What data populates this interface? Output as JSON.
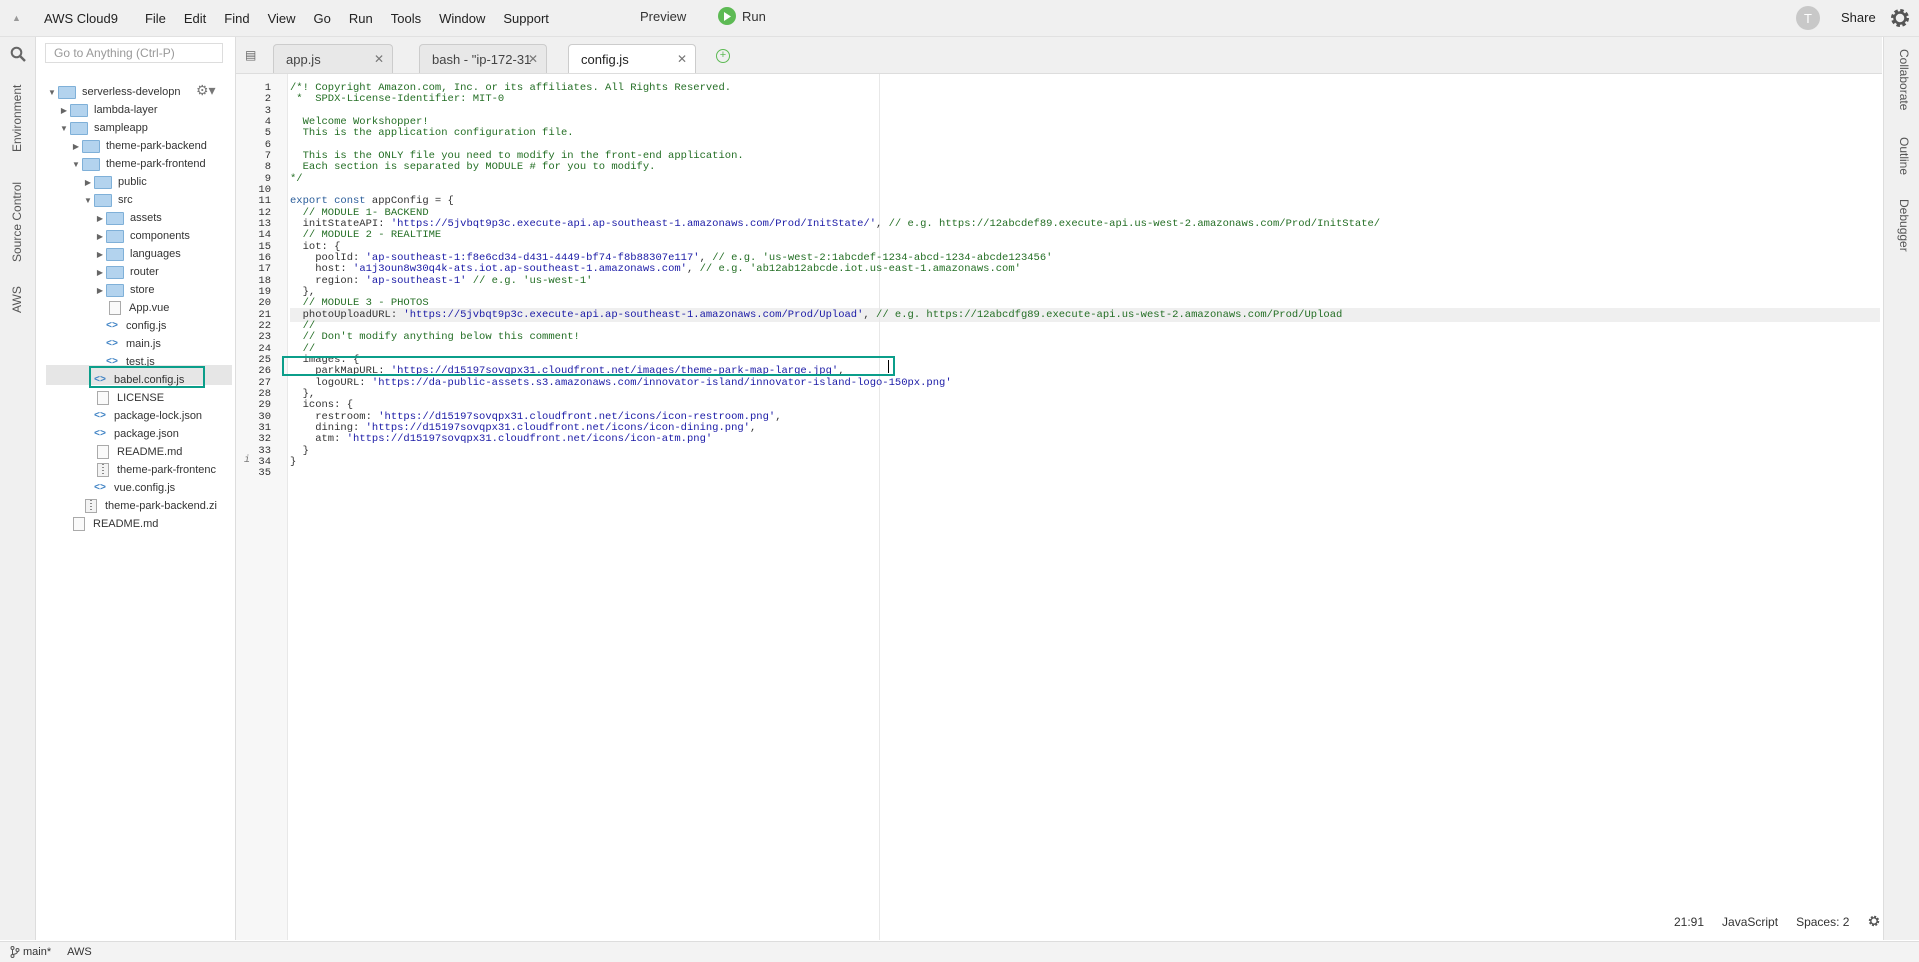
{
  "menubar": {
    "brand": "AWS Cloud9",
    "items": [
      "File",
      "Edit",
      "Find",
      "View",
      "Go",
      "Run",
      "Tools",
      "Window",
      "Support"
    ],
    "preview": "Preview",
    "run": "Run",
    "avatar_initial": "T",
    "share": "Share"
  },
  "left_tabs": [
    "Environment",
    "Source Control",
    "AWS"
  ],
  "right_tabs": [
    "Collaborate",
    "Outline",
    "Debugger"
  ],
  "goto": {
    "placeholder": "Go to Anything (Ctrl-P)"
  },
  "tree": [
    {
      "label": "serverless-developn",
      "kind": "folder",
      "expanded": true,
      "depth": 0
    },
    {
      "label": "lambda-layer",
      "kind": "folder",
      "expanded": false,
      "depth": 1
    },
    {
      "label": "sampleapp",
      "kind": "folder",
      "expanded": true,
      "depth": 1
    },
    {
      "label": "theme-park-backend",
      "kind": "folder",
      "expanded": false,
      "depth": 2
    },
    {
      "label": "theme-park-frontend",
      "kind": "folder",
      "expanded": true,
      "depth": 2
    },
    {
      "label": "public",
      "kind": "folder",
      "expanded": false,
      "depth": 3
    },
    {
      "label": "src",
      "kind": "folder",
      "expanded": true,
      "depth": 3
    },
    {
      "label": "assets",
      "kind": "folder",
      "expanded": false,
      "depth": 4
    },
    {
      "label": "components",
      "kind": "folder",
      "expanded": false,
      "depth": 4
    },
    {
      "label": "languages",
      "kind": "folder",
      "expanded": false,
      "depth": 4
    },
    {
      "label": "router",
      "kind": "folder",
      "expanded": false,
      "depth": 4
    },
    {
      "label": "store",
      "kind": "folder",
      "expanded": false,
      "depth": 4
    },
    {
      "label": "App.vue",
      "kind": "file",
      "depth": 4
    },
    {
      "label": "config.js",
      "kind": "code",
      "depth": 4,
      "selected": true
    },
    {
      "label": "main.js",
      "kind": "code",
      "depth": 4
    },
    {
      "label": "test.js",
      "kind": "code",
      "depth": 4
    },
    {
      "label": "babel.config.js",
      "kind": "code",
      "depth": 3
    },
    {
      "label": "LICENSE",
      "kind": "file",
      "depth": 3
    },
    {
      "label": "package-lock.json",
      "kind": "code",
      "depth": 3
    },
    {
      "label": "package.json",
      "kind": "code",
      "depth": 3
    },
    {
      "label": "README.md",
      "kind": "file",
      "depth": 3
    },
    {
      "label": "theme-park-frontenc",
      "kind": "zip",
      "depth": 3
    },
    {
      "label": "vue.config.js",
      "kind": "code",
      "depth": 3
    },
    {
      "label": "theme-park-backend.zi",
      "kind": "zip",
      "depth": 2
    },
    {
      "label": "README.md",
      "kind": "file",
      "depth": 1
    }
  ],
  "tabs": [
    {
      "label": "app.js",
      "active": false
    },
    {
      "label": "bash - \"ip-172-31",
      "active": false
    },
    {
      "label": "config.js",
      "active": true
    }
  ],
  "code_lines": [
    [
      {
        "t": "/*! Copyright Amazon.com, Inc. or its affiliates. All Rights Reserved.",
        "c": "comment"
      }
    ],
    [
      {
        "t": " *  SPDX-License-Identifier: MIT-0",
        "c": "comment"
      }
    ],
    [
      {
        "t": "",
        "c": ""
      }
    ],
    [
      {
        "t": "  Welcome Workshopper!",
        "c": "comment"
      }
    ],
    [
      {
        "t": "  This is the application configuration file.",
        "c": "comment"
      }
    ],
    [
      {
        "t": "",
        "c": ""
      }
    ],
    [
      {
        "t": "  This is the ONLY file you need to modify in the front-end application.",
        "c": "comment"
      }
    ],
    [
      {
        "t": "  Each section is separated by MODULE # for you to modify.",
        "c": "comment"
      }
    ],
    [
      {
        "t": "*/",
        "c": "comment"
      }
    ],
    [
      {
        "t": "",
        "c": ""
      }
    ],
    [
      {
        "t": "export const ",
        "c": "kw"
      },
      {
        "t": "appConfig = {",
        "c": ""
      }
    ],
    [
      {
        "t": "  // MODULE 1- BACKEND",
        "c": "comment"
      }
    ],
    [
      {
        "t": "  initStateAPI: ",
        "c": ""
      },
      {
        "t": "'https://5jvbqt9p3c.execute-api.ap-southeast-1.amazonaws.com/Prod/InitState/'",
        "c": "str"
      },
      {
        "t": ", ",
        "c": ""
      },
      {
        "t": "// e.g. https://12abcdef89.execute-api.us-west-2.amazonaws.com/Prod/InitState/",
        "c": "comment"
      }
    ],
    [
      {
        "t": "  // MODULE 2 - REALTIME",
        "c": "comment"
      }
    ],
    [
      {
        "t": "  iot: {",
        "c": ""
      }
    ],
    [
      {
        "t": "    poolId: ",
        "c": ""
      },
      {
        "t": "'ap-southeast-1:f8e6cd34-d431-4449-bf74-f8b88307e117'",
        "c": "str"
      },
      {
        "t": ", ",
        "c": ""
      },
      {
        "t": "// e.g. 'us-west-2:1abcdef-1234-abcd-1234-abcde123456'",
        "c": "comment"
      }
    ],
    [
      {
        "t": "    host: ",
        "c": ""
      },
      {
        "t": "'a1j3oun8w30q4k-ats.iot.ap-southeast-1.amazonaws.com'",
        "c": "str"
      },
      {
        "t": ", ",
        "c": ""
      },
      {
        "t": "// e.g. 'ab12ab12abcde.iot.us-east-1.amazonaws.com'",
        "c": "comment"
      }
    ],
    [
      {
        "t": "    region: ",
        "c": ""
      },
      {
        "t": "'ap-southeast-1'",
        "c": "str"
      },
      {
        "t": " ",
        "c": ""
      },
      {
        "t": "// e.g. 'us-west-1'",
        "c": "comment"
      }
    ],
    [
      {
        "t": "  },",
        "c": ""
      }
    ],
    [
      {
        "t": "  // MODULE 3 - PHOTOS",
        "c": "comment"
      }
    ],
    [
      {
        "t": "  photoUploadURL: ",
        "c": ""
      },
      {
        "t": "'https://5jvbqt9p3c.execute-api.ap-southeast-1.amazonaws.com/Prod/Upload'",
        "c": "str"
      },
      {
        "t": ", ",
        "c": ""
      },
      {
        "t": "// e.g. https://12abcdfg89.execute-api.us-west-2.amazonaws.com/Prod/Upload",
        "c": "comment"
      }
    ],
    [
      {
        "t": "  //",
        "c": "comment"
      }
    ],
    [
      {
        "t": "  // Don't modify anything below this comment!",
        "c": "comment"
      }
    ],
    [
      {
        "t": "  //",
        "c": "comment"
      }
    ],
    [
      {
        "t": "  images: {",
        "c": ""
      }
    ],
    [
      {
        "t": "    parkMapURL: ",
        "c": ""
      },
      {
        "t": "'https://d15197sovqpx31.cloudfront.net/images/theme-park-map-large.jpg'",
        "c": "str"
      },
      {
        "t": ",",
        "c": ""
      }
    ],
    [
      {
        "t": "    logoURL: ",
        "c": ""
      },
      {
        "t": "'https://da-public-assets.s3.amazonaws.com/innovator-island/innovator-island-logo-150px.png'",
        "c": "str"
      }
    ],
    [
      {
        "t": "  },",
        "c": ""
      }
    ],
    [
      {
        "t": "  icons: {",
        "c": ""
      }
    ],
    [
      {
        "t": "    restroom: ",
        "c": ""
      },
      {
        "t": "'https://d15197sovqpx31.cloudfront.net/icons/icon-restroom.png'",
        "c": "str"
      },
      {
        "t": ",",
        "c": ""
      }
    ],
    [
      {
        "t": "    dining: ",
        "c": ""
      },
      {
        "t": "'https://d15197sovqpx31.cloudfront.net/icons/icon-dining.png'",
        "c": "str"
      },
      {
        "t": ",",
        "c": ""
      }
    ],
    [
      {
        "t": "    atm: ",
        "c": ""
      },
      {
        "t": "'https://d15197sovqpx31.cloudfront.net/icons/icon-atm.png'",
        "c": "str"
      }
    ],
    [
      {
        "t": "  }",
        "c": ""
      }
    ],
    [
      {
        "t": "}",
        "c": ""
      }
    ],
    [
      {
        "t": "",
        "c": ""
      }
    ]
  ],
  "editor_status": {
    "cursor_pos": "21:91",
    "language": "JavaScript",
    "spaces": "Spaces: 2"
  },
  "statusbar": {
    "branch": "main*",
    "aws": "AWS"
  },
  "colors": {
    "accent_highlight": "#0b9e8a",
    "run_green": "#5dba54"
  }
}
